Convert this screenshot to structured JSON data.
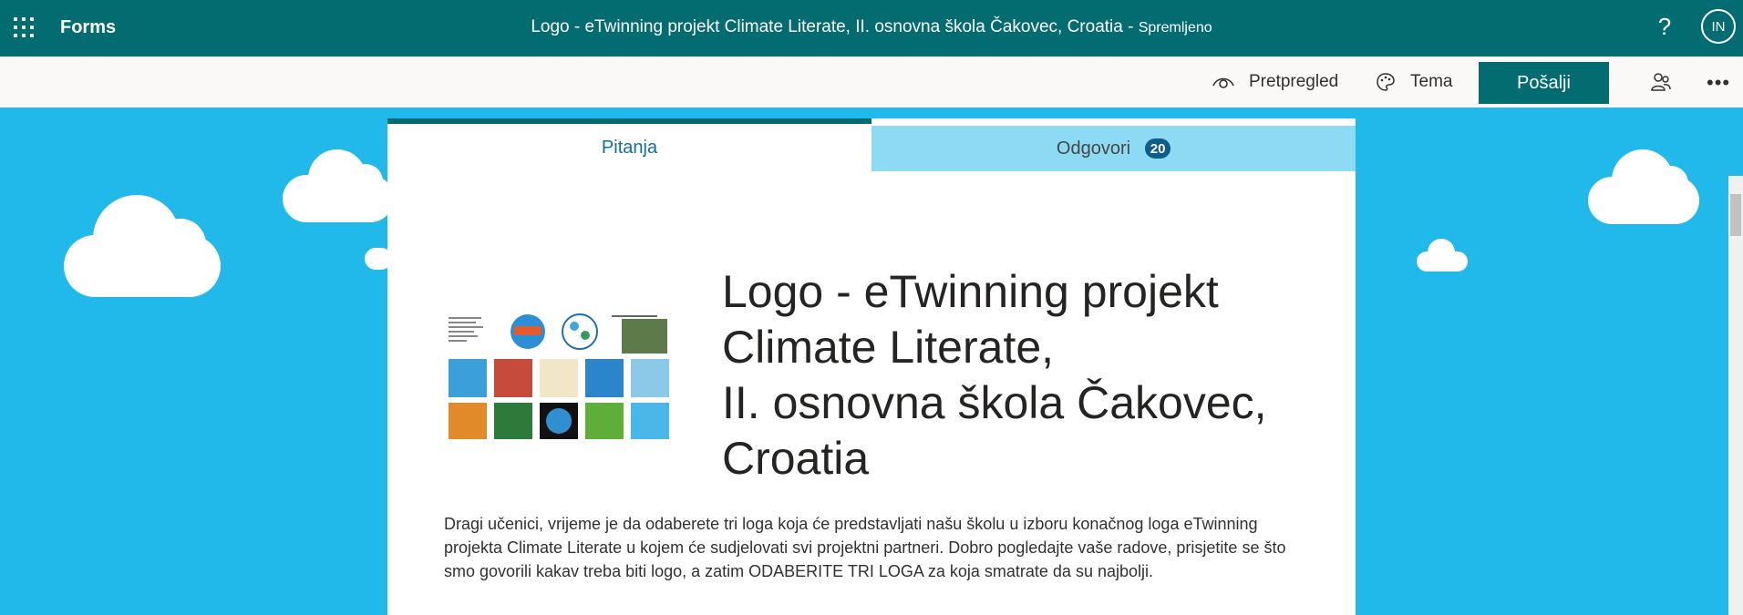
{
  "topbar": {
    "app_name": "Forms",
    "doc_title": "Logo - eTwinning projekt Climate Literate, II. osnovna škola Čakovec, Croatia",
    "separator": " - ",
    "save_status": "Spremljeno",
    "help_label": "?",
    "avatar_initials": "IN",
    "color": "#036c70"
  },
  "commandbar": {
    "preview_label": "Pretpregled",
    "theme_label": "Tema",
    "send_label": "Pošalji"
  },
  "tabs": [
    {
      "label": "Pitanja",
      "active": true
    },
    {
      "label": "Odgovori",
      "badge": "20",
      "active": false
    }
  ],
  "form": {
    "title_lines": [
      "Logo - eTwinning projekt",
      "Climate Literate,",
      "II. osnovna škola Čakovec,",
      "Croatia"
    ],
    "description": "Dragi učenici, vrijeme je da odaberete tri loga koja će predstavljati našu školu u izboru konačnog loga eTwinning projekta Climate Literate u kojem će sudjelovati svi projektni partneri. Dobro pogledajte vaše radove, prisjetite se što smo govorili kakav treba biti logo, a zatim ODABERITE TRI LOGA za koja smatrate da su najbolji."
  },
  "theme": {
    "background": "#21b8ea",
    "tab_inactive": "#8ddaf5",
    "accent": "#0e70a8"
  }
}
